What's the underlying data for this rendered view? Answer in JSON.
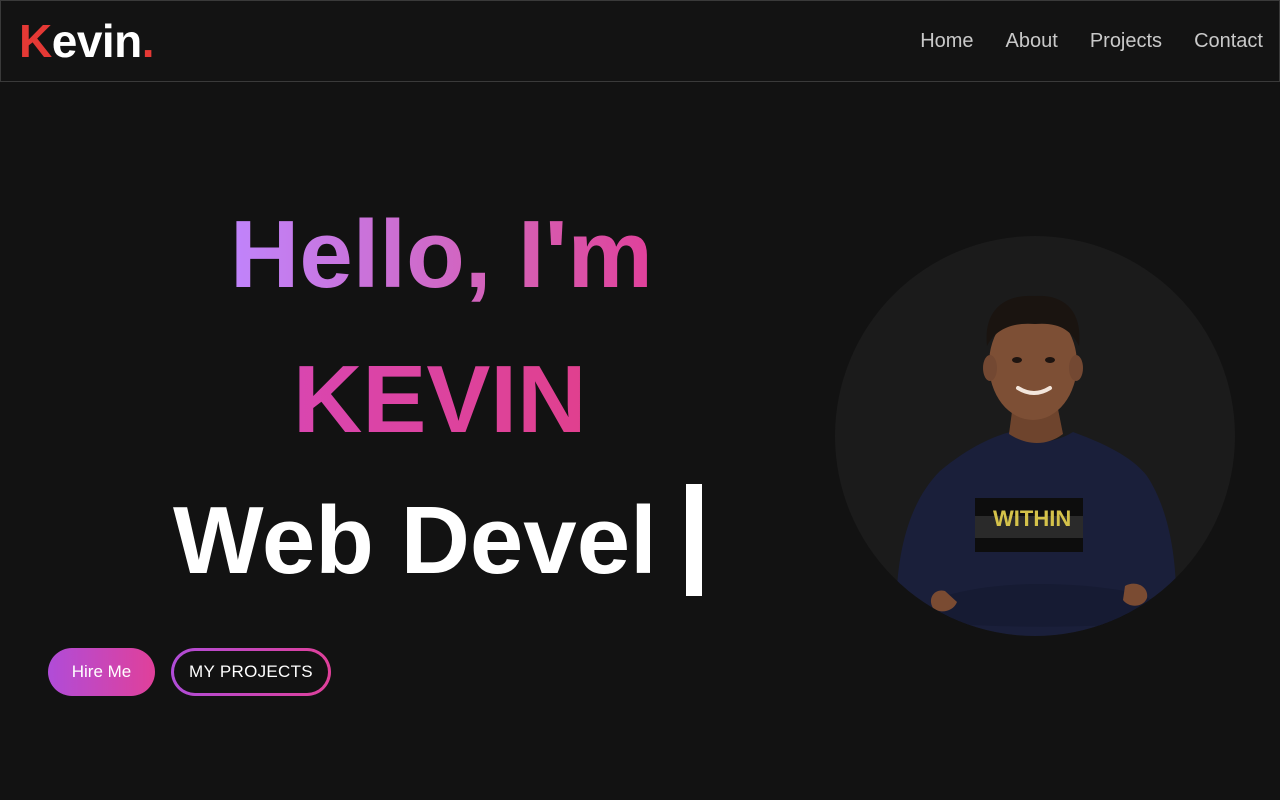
{
  "header": {
    "logo_first": "K",
    "logo_rest": "evin",
    "logo_dot": ".",
    "nav": [
      {
        "label": "Home"
      },
      {
        "label": "About"
      },
      {
        "label": "Projects"
      },
      {
        "label": "Contact"
      }
    ]
  },
  "hero": {
    "greeting": "Hello, I'm",
    "name": "KEVIN",
    "role_typed": "Web Devel",
    "hire_label": "Hire Me",
    "projects_label": "MY PROJECTS",
    "shirt_text": "WITHIN"
  },
  "colors": {
    "background": "#121212",
    "accent_red": "#e53935",
    "gradient_start": "#c084fc",
    "gradient_end": "#e0409a"
  }
}
